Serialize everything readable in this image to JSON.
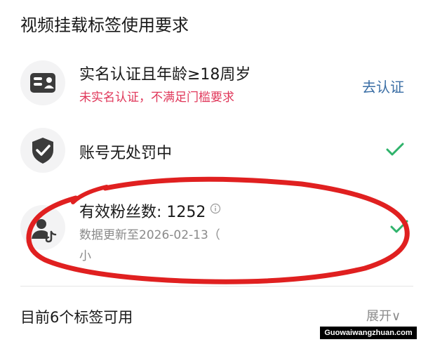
{
  "page": {
    "title": "视频挂载标签使用要求"
  },
  "requirements": [
    {
      "icon": "id-card-icon",
      "title": "实名认证且年龄≥18周岁",
      "warning": "未实名认证，不满足门槛要求",
      "action": "去认证"
    },
    {
      "icon": "shield-check-icon",
      "title": "账号无处罚中",
      "status": "check-icon"
    },
    {
      "icon": "fans-icon",
      "title": "有效粉丝数: 1252",
      "info_icon": "info-icon",
      "subtitle_line1": "数据更新至2026-02-13（",
      "subtitle_line2": "小",
      "status": "check-icon"
    }
  ],
  "footer": {
    "available_tags": "目前6个标签可用",
    "expand_label": "展开∨"
  },
  "watermark": "Guowaiwangzhuan.com",
  "colors": {
    "warning": "#e0375a",
    "link": "#3a6ea5",
    "check": "#2fb36b",
    "annotation": "#e02020"
  }
}
